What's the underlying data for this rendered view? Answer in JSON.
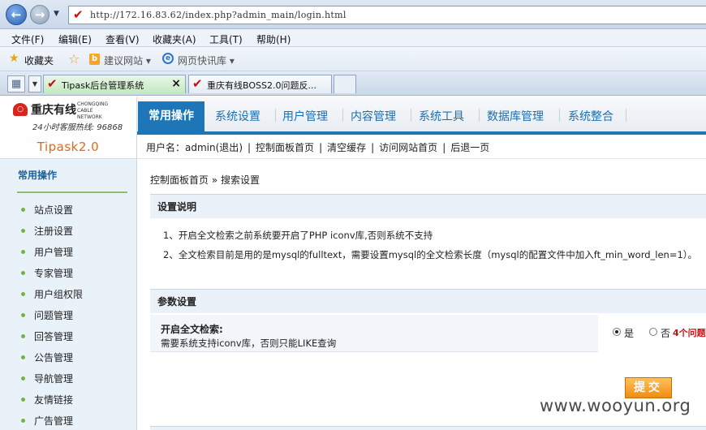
{
  "browser": {
    "url": "http://172.16.83.62/index.php?admin_main/login.html",
    "menu": [
      "文件(F)",
      "编辑(E)",
      "查看(V)",
      "收藏夹(A)",
      "工具(T)",
      "帮助(H)"
    ],
    "favorites_label": "收藏夹",
    "suggested_sites": "建议网站 ▾",
    "web_slice_gallery": "网页快讯库 ▾",
    "tabs": [
      {
        "title": "Tipask后台管理系统",
        "active": true
      },
      {
        "title": "重庆有线BOSS2.0问题反...",
        "active": false
      }
    ],
    "close_glyph": "×"
  },
  "logo": {
    "name": "重庆有线",
    "english": "CHONGQING CABLE NETWORK",
    "hotline": "24小时客服热线: 96868"
  },
  "topnav": {
    "active": "常用操作",
    "items": [
      "系统设置",
      "用户管理",
      "内容管理",
      "系统工具",
      "数据库管理",
      "系统整合"
    ]
  },
  "sidebar": {
    "brand": "Tipask2.0",
    "section": "常用操作",
    "items": [
      "站点设置",
      "注册设置",
      "用户管理",
      "专家管理",
      "用户组权限",
      "问题管理",
      "回答管理",
      "公告管理",
      "导航管理",
      "友情链接",
      "广告管理"
    ]
  },
  "toolbar": {
    "user_prefix": "用户名：admin",
    "logout": "退出",
    "links": [
      "控制面板首页",
      "清空缓存",
      "访问网站首页",
      "后退一页"
    ]
  },
  "main": {
    "breadcrumb": "控制面板首页 » 搜索设置",
    "settings_note_title": "设置说明",
    "notes": [
      "1、开启全文检索之前系统要开启了PHP iconv库,否则系统不支持",
      "2、全文检索目前是用的是mysql的fulltext，需要设置mysql的全文检索长度（mysql的配置文件中加入ft_min_word_len=1）。"
    ],
    "param_title": "参数设置",
    "fulltext_label": "开启全文检索:",
    "fulltext_desc": "需要系统支持iconv库，否则只能LIKE查询",
    "option_yes": "是",
    "option_no": "否",
    "warning": "4个问题",
    "submit": "提交",
    "watermark": "www.wooyun.org"
  }
}
